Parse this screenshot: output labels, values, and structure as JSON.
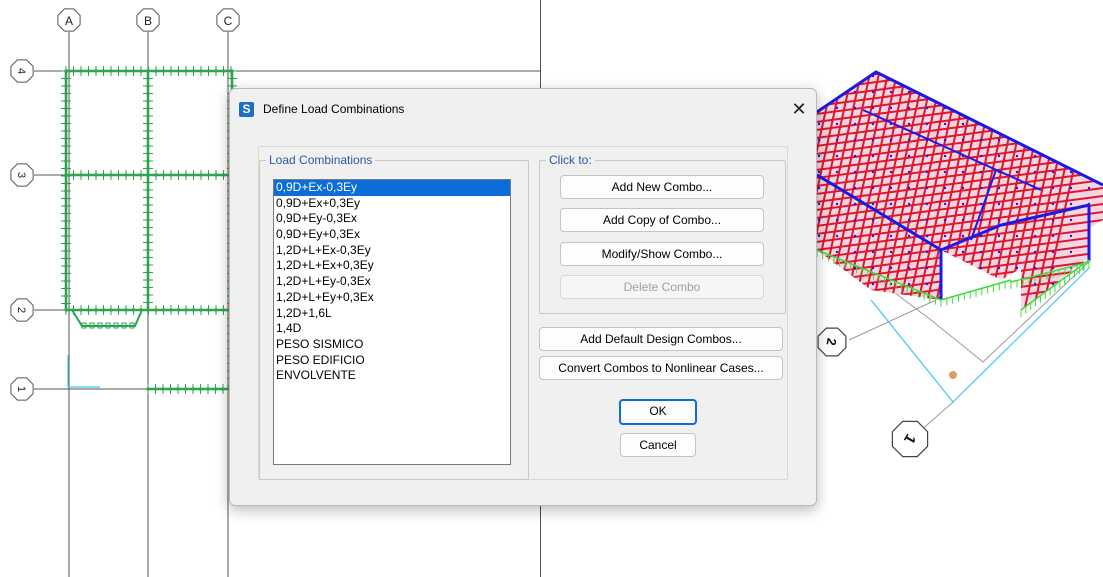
{
  "plan_view": {
    "grid_columns": [
      "A",
      "B",
      "C"
    ],
    "grid_rows": [
      "4",
      "3",
      "2",
      "1"
    ],
    "support_color": "#2ea44f",
    "grid_color": "#555555"
  },
  "view_3d": {
    "frame_color": "#e0162b",
    "beam_color": "#1a1ae6",
    "support_color": "#3ddc3d",
    "axis_color": "#40c8f0",
    "axis_labels": [
      "2",
      "1"
    ]
  },
  "dialog": {
    "app_icon": "S",
    "title": "Define Load Combinations",
    "close_glyph": "✕",
    "load_combinations": {
      "legend": "Load Combinations",
      "items": [
        "0,9D+Ex-0,3Ey",
        "0,9D+Ex+0,3Ey",
        "0,9D+Ey-0,3Ex",
        "0,9D+Ey+0,3Ex",
        "1,2D+L+Ex-0,3Ey",
        "1,2D+L+Ex+0,3Ey",
        "1,2D+L+Ey-0,3Ex",
        "1,2D+L+Ey+0,3Ex",
        "1,2D+1,6L",
        "1,4D",
        "PESO SISMICO",
        "PESO EDIFICIO",
        "ENVOLVENTE"
      ],
      "selected": "0,9D+Ex-0,3Ey"
    },
    "click_to": {
      "legend": "Click to:",
      "add_new": "Add New Combo...",
      "add_copy": "Add Copy of Combo...",
      "modify_show": "Modify/Show Combo...",
      "delete": "Delete Combo"
    },
    "add_default": "Add Default Design Combos...",
    "convert": "Convert Combos to Nonlinear Cases...",
    "ok": "OK",
    "cancel": "Cancel"
  }
}
